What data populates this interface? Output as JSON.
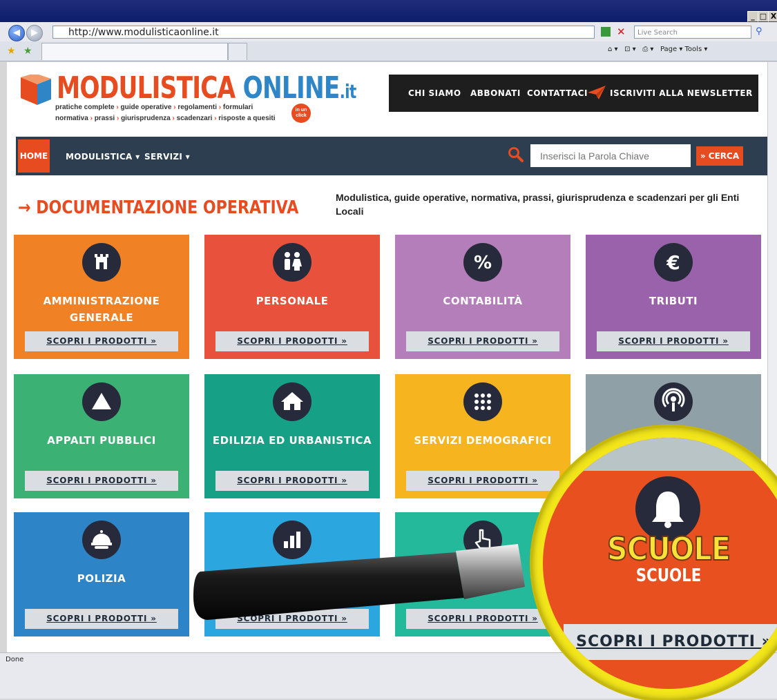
{
  "browser": {
    "url": "http://www.modulisticaonline.it",
    "search_placeholder": "Live Search",
    "toolbar": "Page ▾   Tools ▾",
    "status": "Done",
    "window_min": "_",
    "window_max": "□",
    "window_close": "X"
  },
  "site": {
    "logo_main": "MODULISTICA",
    "logo_online": "ONLINE",
    "logo_tld": ".it",
    "tagline": [
      [
        "pratiche complete",
        "guide operative",
        "regolamenti",
        "formulari"
      ],
      [
        "normativa",
        "prassi",
        "giurisprudenza",
        "scadenzari",
        "risposte a quesiti"
      ]
    ],
    "badge": "in un click",
    "topnav": [
      "CHI SIAMO",
      "ABBONATI",
      "CONTATTACI",
      "ISCRIVITI ALLA NEWSLETTER"
    ],
    "nav": {
      "home": "HOME",
      "modulistica": "MODULISTICA ▾",
      "servizi": "SERVIZI ▾",
      "search_placeholder": "Inserisci la Parola Chiave",
      "search_button": "» CERCA"
    },
    "section_title": "→ DOCUMENTAZIONE OPERATIVA",
    "section_desc": "Modulistica, guide operative, normativa, prassi, giurisprudenza e scadenzari per gli Enti Locali",
    "cta": "SCOPRI I PRODOTTI »"
  },
  "tiles": [
    {
      "title": "AMMINISTRAZIONE GENERALE",
      "color": "#f08225",
      "icon": "tower-icon"
    },
    {
      "title": "PERSONALE",
      "color": "#e8513b",
      "icon": "people-icon"
    },
    {
      "title": "CONTABILITÀ",
      "color": "#b47ebb",
      "icon": "percent-icon"
    },
    {
      "title": "TRIBUTI",
      "color": "#9a62aa",
      "icon": "euro-icon"
    },
    {
      "title": "APPALTI PUBBLICI",
      "color": "#3bb273",
      "icon": "triangle-icon"
    },
    {
      "title": "EDILIZIA ED URBANISTICA",
      "color": "#16a085",
      "icon": "house-icon"
    },
    {
      "title": "SERVIZI DEMOGRAFICI",
      "color": "#f6b51e",
      "icon": "grid-dots-icon"
    },
    {
      "title": "",
      "color": "#8fa1a7",
      "icon": "podcast-icon"
    },
    {
      "title": "POLIZIA",
      "color": "#2d85c7",
      "icon": "helmet-icon"
    },
    {
      "title": "",
      "color": "#2ca6df",
      "icon": "bar-chart-icon"
    },
    {
      "title": "",
      "color": "#25b99b",
      "icon": "hand-pointer-icon"
    }
  ],
  "magnifier": {
    "big_label": "SCUOLE",
    "small_label": "SCUOLE",
    "button": "SCOPRI I PRODOTTI »",
    "icon": "bell-icon",
    "color": "#e8501f"
  }
}
